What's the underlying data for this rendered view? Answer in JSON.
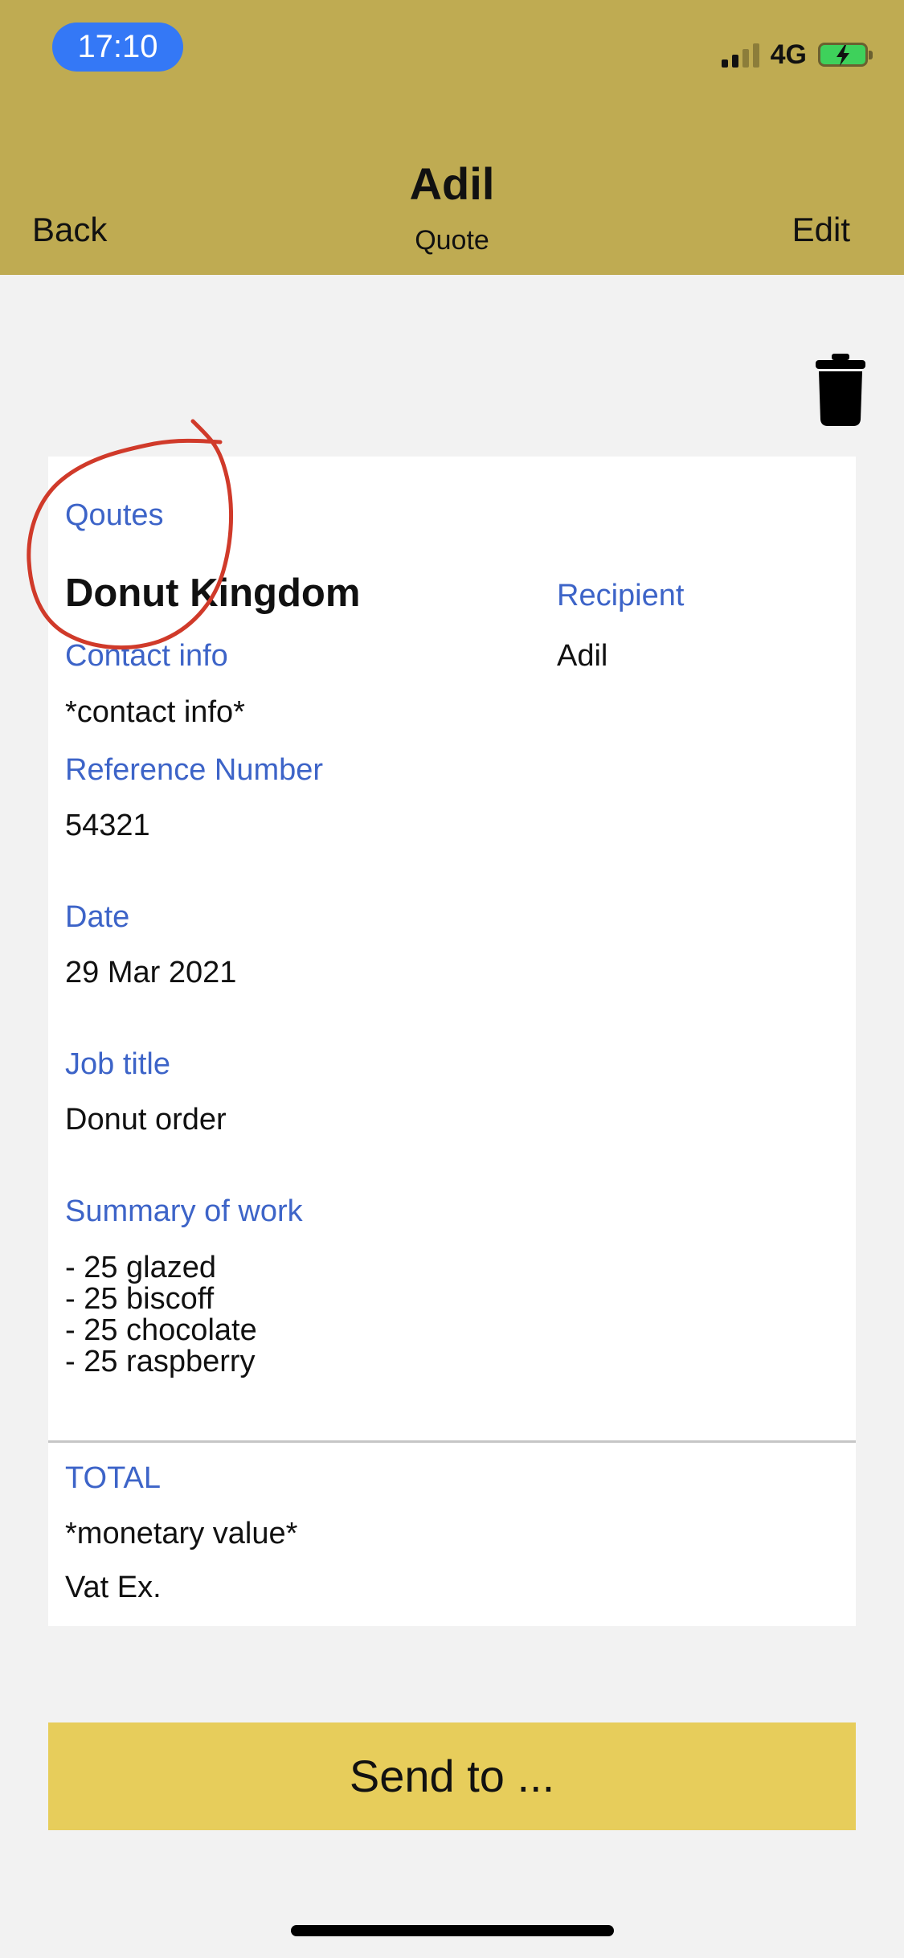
{
  "status_bar": {
    "time": "17:10",
    "network": "4G",
    "signal_bars_active": 2,
    "signal_bars_total": 4,
    "battery_color": "#3ed15b"
  },
  "nav": {
    "title": "Adil",
    "subtitle": "Quote",
    "back_label": "Back",
    "edit_label": "Edit",
    "delete_icon": "trash-icon"
  },
  "quote": {
    "section_label": "Qoutes",
    "company": "Donut Kingdom",
    "recipient_label": "Recipient",
    "recipient_value": "Adil",
    "contact_label": "Contact info",
    "contact_value": "*contact info*",
    "reference_label": "Reference Number",
    "reference_value": "54321",
    "date_label": "Date",
    "date_value": "29 Mar 2021",
    "job_title_label": "Job title",
    "job_title_value": "Donut order",
    "summary_label": "Summary of work",
    "summary_items": [
      "- 25 glazed",
      "- 25 biscoff",
      "- 25 chocolate",
      "- 25 raspberry"
    ],
    "total_label": "TOTAL",
    "total_value": "*monetary value*",
    "vat_note": "Vat Ex."
  },
  "actions": {
    "send_label": "Send to ..."
  },
  "colors": {
    "header_bg": "#bfab52",
    "label_blue": "#3d64c8",
    "send_button": "#e7cd5b",
    "annotation_red": "#d03a2a"
  }
}
